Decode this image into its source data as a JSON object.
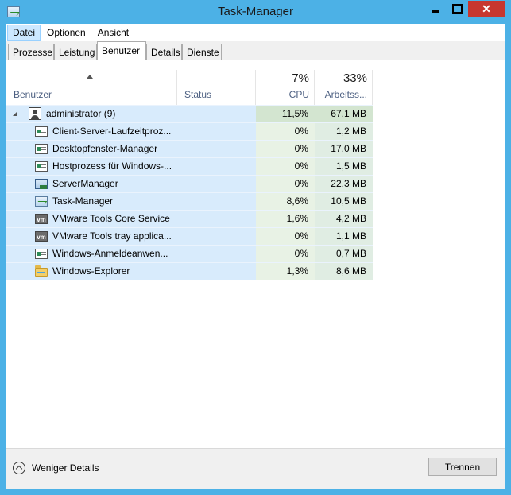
{
  "window": {
    "title": "Task-Manager"
  },
  "menu": [
    "Datei",
    "Optionen",
    "Ansicht"
  ],
  "tabs": [
    "Prozesse",
    "Leistung",
    "Benutzer",
    "Details",
    "Dienste"
  ],
  "selected_tab": "Benutzer",
  "columns": {
    "user": "Benutzer",
    "status": "Status",
    "cpu": {
      "percent": "7%",
      "label": "CPU"
    },
    "memory": {
      "percent": "33%",
      "label": "Arbeitss..."
    }
  },
  "group": {
    "name": "administrator (9)",
    "cpu": "11,5%",
    "memory": "67,1 MB"
  },
  "processes": [
    {
      "name": "Client-Server-Laufzeitproz...",
      "cpu": "0%",
      "memory": "1,2 MB",
      "icon": "window-icon"
    },
    {
      "name": "Desktopfenster-Manager",
      "cpu": "0%",
      "memory": "17,0 MB",
      "icon": "window-icon"
    },
    {
      "name": "Hostprozess für Windows-...",
      "cpu": "0%",
      "memory": "1,5 MB",
      "icon": "window-icon"
    },
    {
      "name": "ServerManager",
      "cpu": "0%",
      "memory": "22,3 MB",
      "icon": "server-manager-icon"
    },
    {
      "name": "Task-Manager",
      "cpu": "8,6%",
      "memory": "10,5 MB",
      "icon": "task-manager-icon"
    },
    {
      "name": "VMware Tools Core Service",
      "cpu": "1,6%",
      "memory": "4,2 MB",
      "icon": "vmware-icon"
    },
    {
      "name": "VMware Tools tray applica...",
      "cpu": "0%",
      "memory": "1,1 MB",
      "icon": "vmware-icon"
    },
    {
      "name": "Windows-Anmeldeanwen...",
      "cpu": "0%",
      "memory": "0,7 MB",
      "icon": "window-icon"
    },
    {
      "name": "Windows-Explorer",
      "cpu": "1,3%",
      "memory": "8,6 MB",
      "icon": "folder-icon"
    }
  ],
  "footer": {
    "fewer_details": "Weniger Details",
    "end_button": "Trennen"
  },
  "colors": {
    "frame": "#4cb1e6",
    "close": "#c7372f",
    "row_selected": "#d8ebfc"
  }
}
